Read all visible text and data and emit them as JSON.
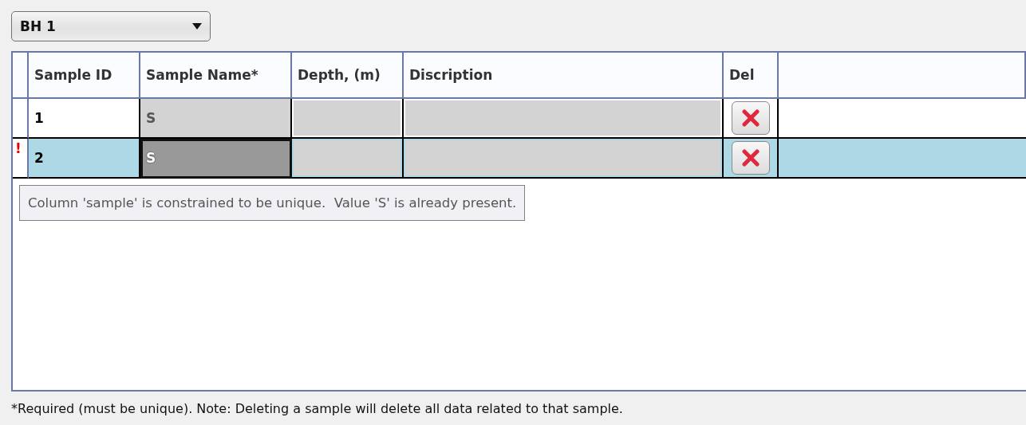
{
  "dropdown": {
    "value": "BH 1"
  },
  "table": {
    "columns": [
      "Sample ID",
      "Sample Name*",
      "Depth, (m)",
      "Discription",
      "Del"
    ],
    "rows": [
      {
        "sample_id": "1",
        "sample_name": "S",
        "depth_m": "",
        "discription": "",
        "selected": false,
        "error_mark": "",
        "name_focused": false
      },
      {
        "sample_id": "2",
        "sample_name": "S",
        "depth_m": "",
        "discription": "",
        "selected": true,
        "error_mark": "!",
        "name_focused": true
      }
    ]
  },
  "tooltip": "Column 'sample' is constrained to be unique.  Value 'S' is already present.",
  "footnote": "*Required (must be unique). Note: Deleting a sample will delete all data related to that sample."
}
